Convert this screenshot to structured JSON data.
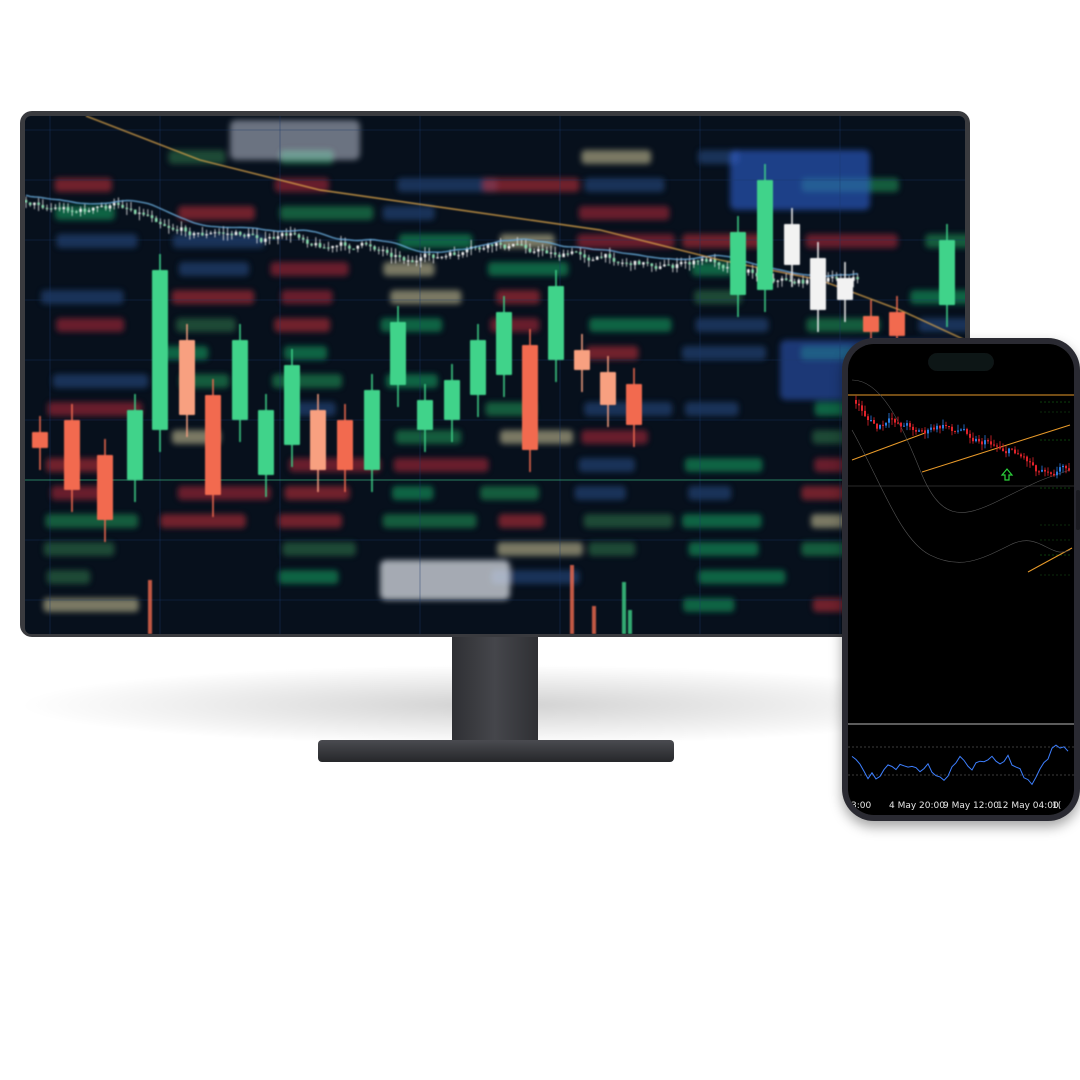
{
  "colors": {
    "background": "#ffffff",
    "monitor_bezel": "#3a3b3f",
    "monitor_screen": "#07101c",
    "bull": "#3fd38a",
    "bear": "#f26a4f",
    "phone_body": "#2b2c30",
    "phone_screen": "#000000",
    "phone_bear": "#e0242a",
    "phone_bull": "#2a7be0",
    "trendline": "#e89a2a",
    "indicator_line": "#3d7fff",
    "signal_arrow": "#2bd13a"
  },
  "monitor": {
    "screen_content": "blurred candlestick chart with moving averages and a background price table"
  },
  "phone": {
    "time_axis_labels": [
      "3:00",
      "4 May 20:00",
      "9 May 12:00",
      "12 May 04:00",
      "1("
    ],
    "signal_icon": "up-arrow-icon"
  }
}
